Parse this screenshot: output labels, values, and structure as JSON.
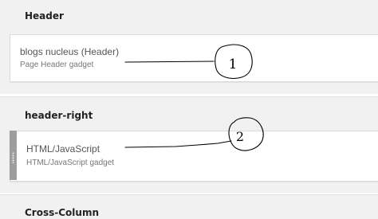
{
  "sections": [
    {
      "title": "Header",
      "gadget": {
        "name": "blogs nucleus (Header)",
        "type": "Page Header gadget",
        "annotation": "1"
      }
    },
    {
      "title": "header-right",
      "gadget": {
        "name": "HTML/JavaScript",
        "type": "HTML/JavaScript gadget",
        "annotation": "2"
      }
    },
    {
      "title": "Cross-Column"
    }
  ],
  "colors": {
    "section_background": "#f1f1f1",
    "gadget_background": "#ffffff",
    "drag_handle": "#9e9e9e",
    "annotation_ink": "#000000"
  },
  "icons": {
    "drag_handle": "drag-handle-icon"
  }
}
